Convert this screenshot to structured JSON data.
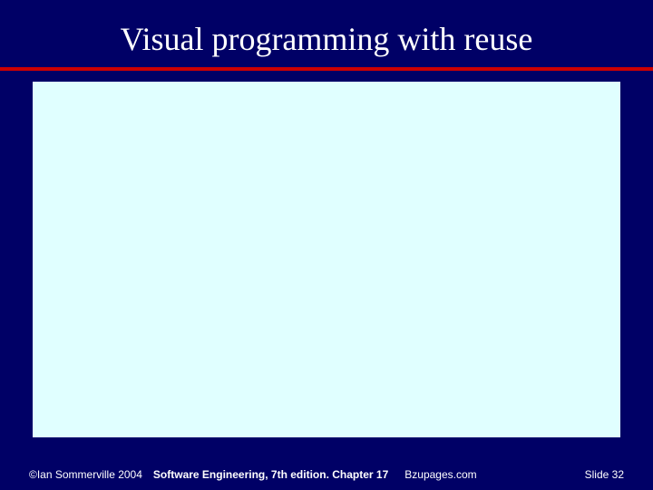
{
  "title": "Visual programming with reuse",
  "footer": {
    "copyright": "©Ian Sommerville 2004",
    "book": "Software Engineering, 7th edition. Chapter 17",
    "site": "Bzupages.com",
    "slide_label": "Slide",
    "slide_number": "32"
  }
}
